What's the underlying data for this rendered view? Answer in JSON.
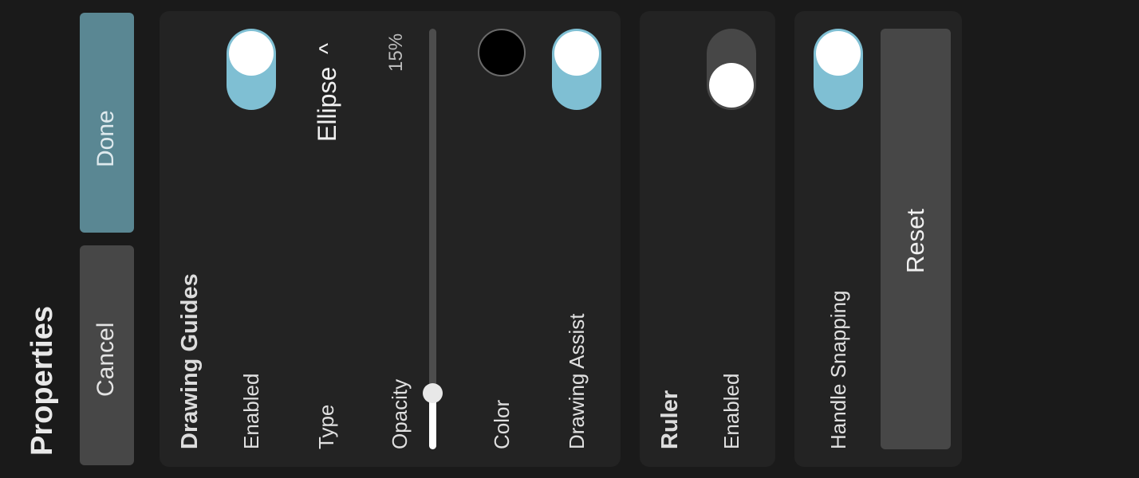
{
  "header": {
    "title": "Properties"
  },
  "actions": {
    "cancel_label": "Cancel",
    "done_label": "Done"
  },
  "drawing_guides": {
    "title": "Drawing Guides",
    "enabled_label": "Enabled",
    "enabled": true,
    "type_label": "Type",
    "type_value": "Ellipse",
    "type_chevron": "^",
    "opacity_label": "Opacity",
    "opacity_value": "15%",
    "opacity_fraction": 0.15,
    "color_label": "Color",
    "color_value": "#000000",
    "drawing_assist_label": "Drawing Assist",
    "drawing_assist": true
  },
  "ruler": {
    "title": "Ruler",
    "enabled_label": "Enabled",
    "enabled": false
  },
  "snapping": {
    "handle_snapping_label": "Handle Snapping",
    "handle_snapping": true,
    "reset_label": "Reset"
  },
  "colors": {
    "background": "#1a1a1a",
    "panel": "#232323",
    "accent": "#7fbfd3",
    "done_button": "#5a8793",
    "secondary_button": "#474747"
  }
}
